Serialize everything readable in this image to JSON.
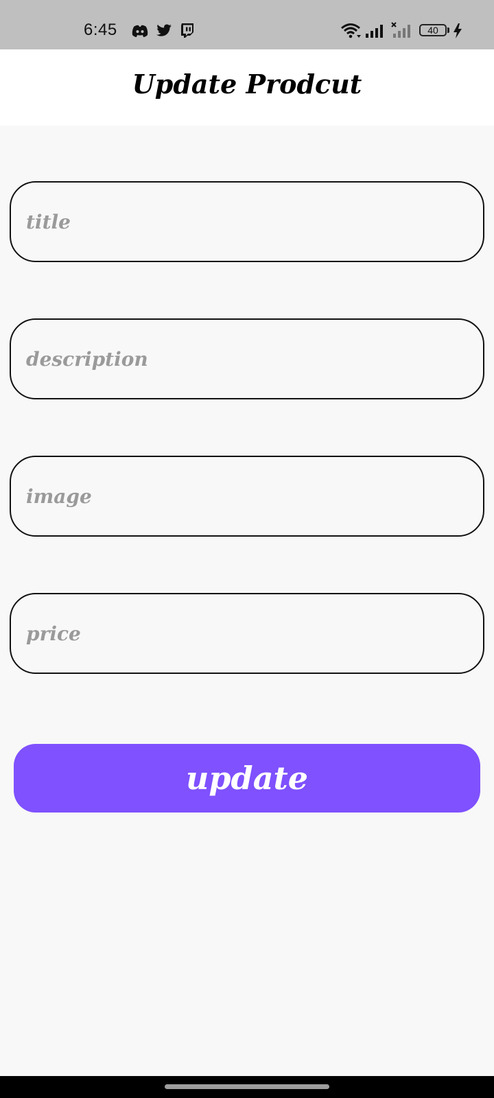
{
  "status_bar": {
    "time": "6:45",
    "notification_icons": [
      "discord-icon",
      "twitter-icon",
      "twitch-icon"
    ],
    "system_icons": [
      "wifi-icon",
      "signal-icon",
      "signal-no-service-icon",
      "battery-icon",
      "charging-icon"
    ],
    "battery_level": "40"
  },
  "header": {
    "title": "Update Prodcut"
  },
  "form": {
    "title_placeholder": "title",
    "description_placeholder": "description",
    "image_placeholder": "image",
    "price_placeholder": "price",
    "submit_label": "update"
  },
  "colors": {
    "accent": "#7f51ff",
    "status_bar": "#bfbfbf",
    "background": "#f8f8f8",
    "placeholder": "#9a9a9a"
  }
}
